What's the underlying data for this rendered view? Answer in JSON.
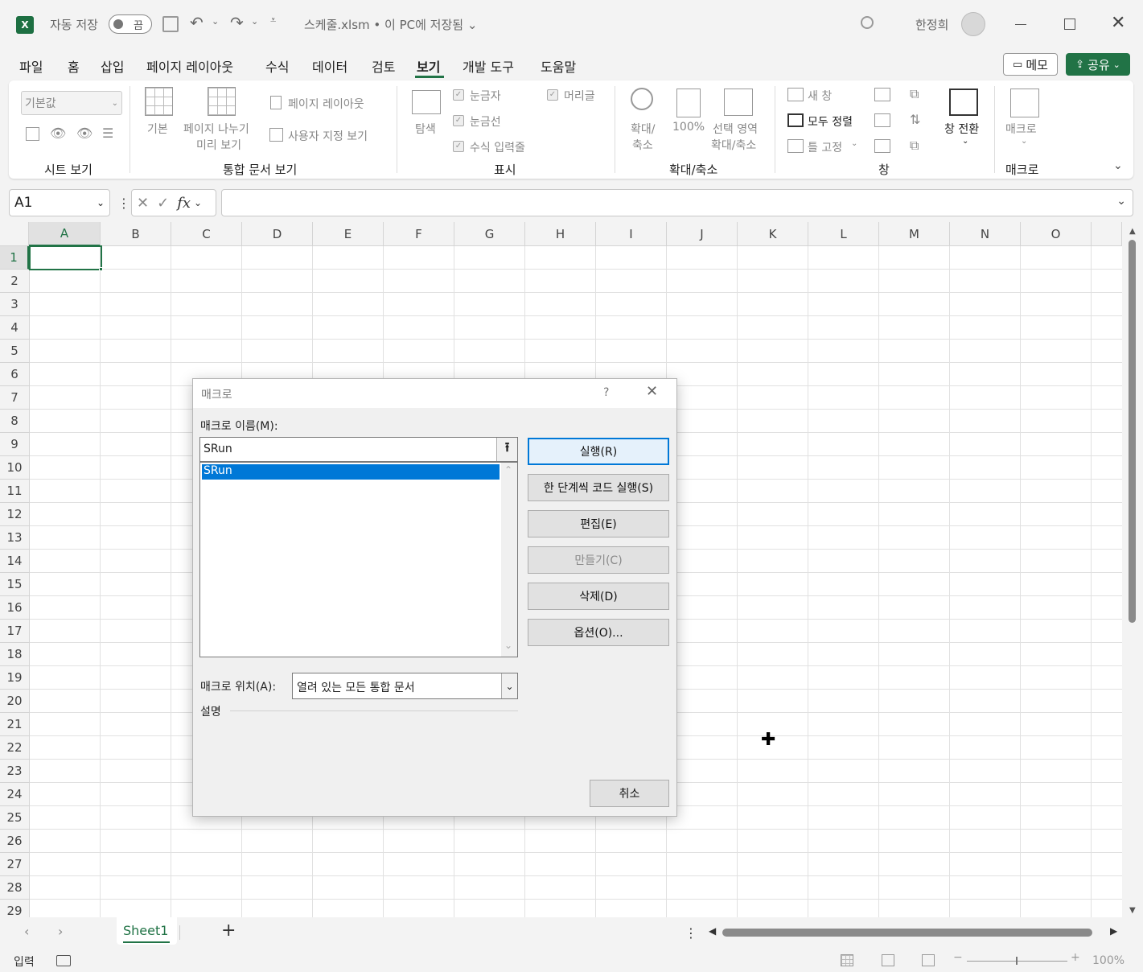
{
  "titlebar": {
    "autosave_label": "자동 저장",
    "autosave_state": "끔",
    "doc_title": "스케줄.xlsm • 이 PC에 저장됨",
    "user_name": "한정희"
  },
  "tabs": [
    "파일",
    "홈",
    "삽입",
    "페이지 레이아웃",
    "수식",
    "데이터",
    "검토",
    "보기",
    "개발 도구",
    "도움말"
  ],
  "active_tab": "보기",
  "memo_label": "메모",
  "share_label": "공유",
  "accent_color": "#217346",
  "ribbon": {
    "sheet_view": {
      "dropdown": "기본값",
      "group": "시트 보기"
    },
    "workbook_views": {
      "normal": "기본",
      "page_break1": "페이지 나누기",
      "page_break2": "미리 보기",
      "page_layout": "페이지 레이아웃",
      "custom_views": "사용자 지정 보기",
      "group": "통합 문서 보기"
    },
    "show": {
      "navigation": "탐색",
      "ruler": "눈금자",
      "gridlines": "눈금선",
      "formula_bar": "수식 입력줄",
      "headings": "머리글",
      "group": "표시"
    },
    "zoom": {
      "zoom1": "확대/",
      "zoom2": "축소",
      "hundred": "100%",
      "sel1": "선택 영역",
      "sel2": "확대/축소",
      "group": "확대/축소"
    },
    "window": {
      "new_window": "새 창",
      "arrange_all": "모두 정렬",
      "freeze": "틀 고정",
      "switch": "창 전환",
      "group": "창"
    },
    "macros": {
      "label": "매크로",
      "group": "매크로"
    }
  },
  "formula": {
    "name_box": "A1",
    "fx": "fx",
    "value": ""
  },
  "columns": [
    "A",
    "B",
    "C",
    "D",
    "E",
    "F",
    "G",
    "H",
    "I",
    "J",
    "K",
    "L",
    "M",
    "N",
    "O"
  ],
  "rows": [
    "1",
    "2",
    "3",
    "4",
    "5",
    "6",
    "7",
    "8",
    "9",
    "10",
    "11",
    "12",
    "13",
    "14",
    "15",
    "16",
    "17",
    "18",
    "19",
    "20",
    "21",
    "22",
    "23",
    "24",
    "25",
    "26",
    "27",
    "28",
    "29"
  ],
  "dialog": {
    "title": "매크로",
    "help": "?",
    "name_label": "매크로 이름(M):",
    "name_value": "SRun",
    "list": [
      "SRun"
    ],
    "buttons": {
      "run": "실행(R)",
      "step": "한 단계씩 코드 실행(S)",
      "edit": "편집(E)",
      "create": "만들기(C)",
      "delete": "삭제(D)",
      "options": "옵션(O)..."
    },
    "location_label": "매크로 위치(A):",
    "location_value": "열려 있는 모든 통합 문서",
    "description_label": "설명",
    "cancel": "취소"
  },
  "sheet_tab": "Sheet1",
  "status": {
    "mode": "입력",
    "zoom": "100%"
  }
}
